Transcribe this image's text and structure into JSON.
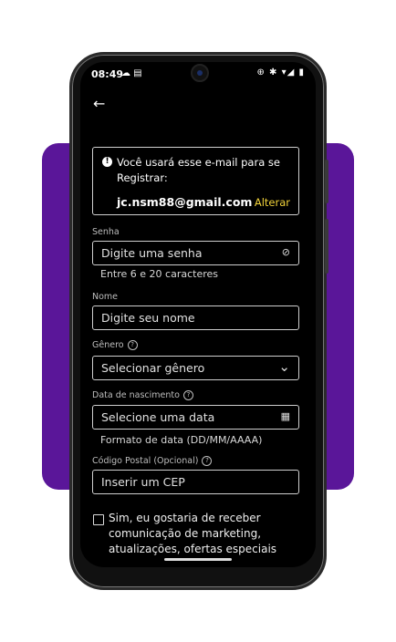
{
  "status_bar": {
    "time": "08:49",
    "left_icons": "☁ ▤",
    "right_icons": "⊕ ✱ ▾◢ ▮"
  },
  "back_label": "←",
  "info": {
    "icon_glyph": "!",
    "message": "Você usará esse e-mail para se Registrar:",
    "email": "jc.nsm88@gmail.com",
    "change_label": "Alterar",
    "change_color": "#f2d33a"
  },
  "password": {
    "label": "Senha",
    "placeholder": "Digite uma senha",
    "toggle_glyph": "⊘",
    "hint": "Entre 6 e 20 caracteres"
  },
  "name": {
    "label": "Nome",
    "placeholder": "Digite seu nome"
  },
  "gender": {
    "label": "Gênero",
    "help_glyph": "?",
    "selected": "Selecionar gênero",
    "chevron_glyph": "⌄"
  },
  "birthdate": {
    "label": "Data de nascimento",
    "help_glyph": "?",
    "placeholder": "Selecione uma data",
    "calendar_glyph": "▦",
    "hint": "Formato de data (DD/MM/AAAA)"
  },
  "postal": {
    "label": "Código Postal (Opcional)",
    "help_glyph": "?",
    "placeholder": "Inserir um CEP"
  },
  "marketing": {
    "text": "Sim, eu gostaria de receber comunicação de marketing, atualizações, ofertas especiais"
  },
  "colors": {
    "brand_purple": "#5a1699",
    "screen_bg": "#000000",
    "accent_yellow": "#f2d33a"
  }
}
